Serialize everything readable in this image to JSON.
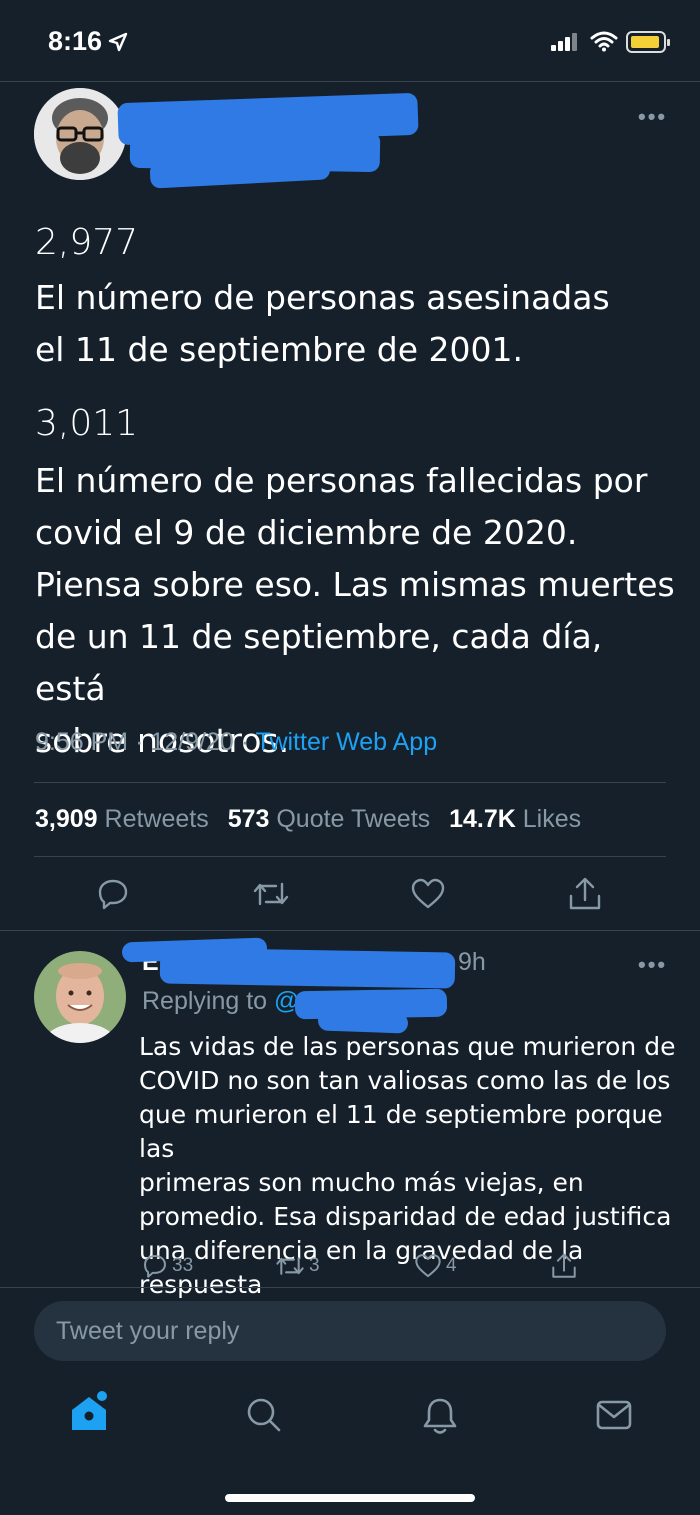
{
  "status_bar": {
    "time": "8:16"
  },
  "tweet": {
    "more_label": "•••",
    "block1_number": "2,977",
    "block1_lines": [
      "El número de personas asesinadas",
      "el 11 de septiembre de 2001."
    ],
    "block2_number": "3,011",
    "block2_lines": [
      "El número de personas fallecidas por",
      "covid el 9 de diciembre de 2020.",
      "Piensa sobre eso. Las mismas muertes",
      "de un 11 de septiembre, cada día, está",
      "sobre nosotros."
    ],
    "time": "9:56 PM",
    "separator": "·",
    "date": "12/9/20",
    "source": "Twitter Web App",
    "retweets_count": "3,909",
    "retweets_label": "Retweets",
    "quotes_count": "573",
    "quotes_label": "Quote Tweets",
    "likes_count": "14.7K",
    "likes_label": "Likes"
  },
  "reply": {
    "name_initial": "E",
    "time": "9h",
    "replying_label": "Replying to",
    "replying_at": "@",
    "more_label": "•••",
    "lines": [
      "Las vidas de las personas que murieron de",
      "COVID no son tan valiosas como las de los",
      "que murieron el 11 de septiembre porque las",
      "primeras son mucho más viejas, en",
      "promedio. Esa disparidad de edad justifica",
      "una diferencia en la gravedad de la respuesta"
    ],
    "reply_count": "33",
    "retweet_count": "3",
    "like_count": "4"
  },
  "compose": {
    "placeholder": "Tweet your reply"
  },
  "colors": {
    "background": "#15202b",
    "accent": "#1da1f2",
    "muted": "#8899a6",
    "redaction": "#2f7ae5"
  },
  "icons": [
    "location-arrow-icon",
    "signal-icon",
    "wifi-icon",
    "battery-icon",
    "reply-icon",
    "retweet-icon",
    "like-icon",
    "share-icon",
    "home-icon",
    "search-icon",
    "notifications-icon",
    "messages-icon"
  ]
}
